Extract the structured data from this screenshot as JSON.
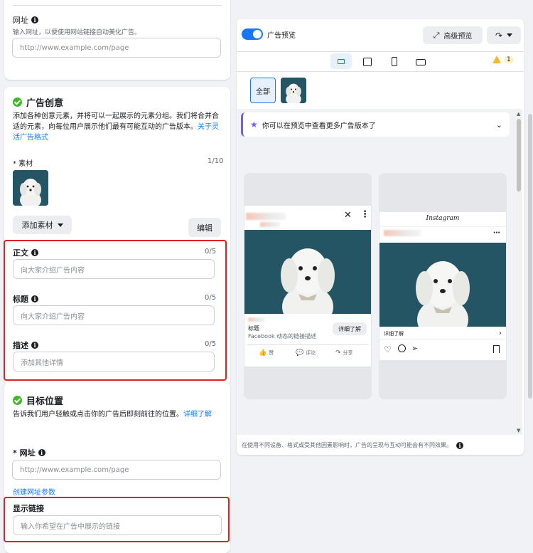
{
  "url_section": {
    "label": "网址",
    "hint": "输入网址，以便使用网站链接自动美化广告。",
    "placeholder": "http://www.example.com/page"
  },
  "creative": {
    "title": "广告创意",
    "description": "添加各种创意元素，并将可以一起展示的元素分组。我们将合并合适的元素，向每位用户展示他们最有可能互动的广告版本。",
    "learn_link": "关于灵活广告格式",
    "assets_label": "* 素材",
    "assets_count": "1/10",
    "add_assets_button": "添加素材",
    "edit_button": "编辑",
    "fields": [
      {
        "label": "正文",
        "count": "0/5",
        "placeholder": "向大家介绍广告内容"
      },
      {
        "label": "标题",
        "count": "0/5",
        "placeholder": "向大家介绍广告内容"
      },
      {
        "label": "描述",
        "count": "0/5",
        "placeholder": "添加其他详情"
      }
    ]
  },
  "destination": {
    "title": "目标位置",
    "description": "告诉我们用户轻触或点击你的广告后即刻前往的位置。",
    "learn_more": "详细了解",
    "url_label": "* 网址",
    "url_placeholder": "http://www.example.com/page",
    "create_params_link": "创建网址参数",
    "display_link_label": "显示链接",
    "display_link_placeholder": "输入你希望在广告中展示的链接"
  },
  "preview": {
    "toggle_label": "广告预览",
    "toggle_on": true,
    "advanced_button": "高级预览",
    "warning_count": "1",
    "filter_all": "全部",
    "banner_text": "你可以在预览中查看更多广告版本了",
    "facebook_card": {
      "headline": "标题",
      "link_description": "Facebook 动态的链接描述",
      "cta": "详细了解",
      "like": "赞",
      "comment": "评论",
      "share": "分享"
    },
    "instagram_card": {
      "brand": "Instagram",
      "cta": "详细了解"
    },
    "footer_note": "在使用不同设备、格式或受其他因素影响时，广告的呈现与互动可能会有不同效果。"
  },
  "colors": {
    "accent": "#1877f2",
    "success": "#42b72a",
    "highlight_red": "#e02020",
    "warning": "#f7b928"
  }
}
